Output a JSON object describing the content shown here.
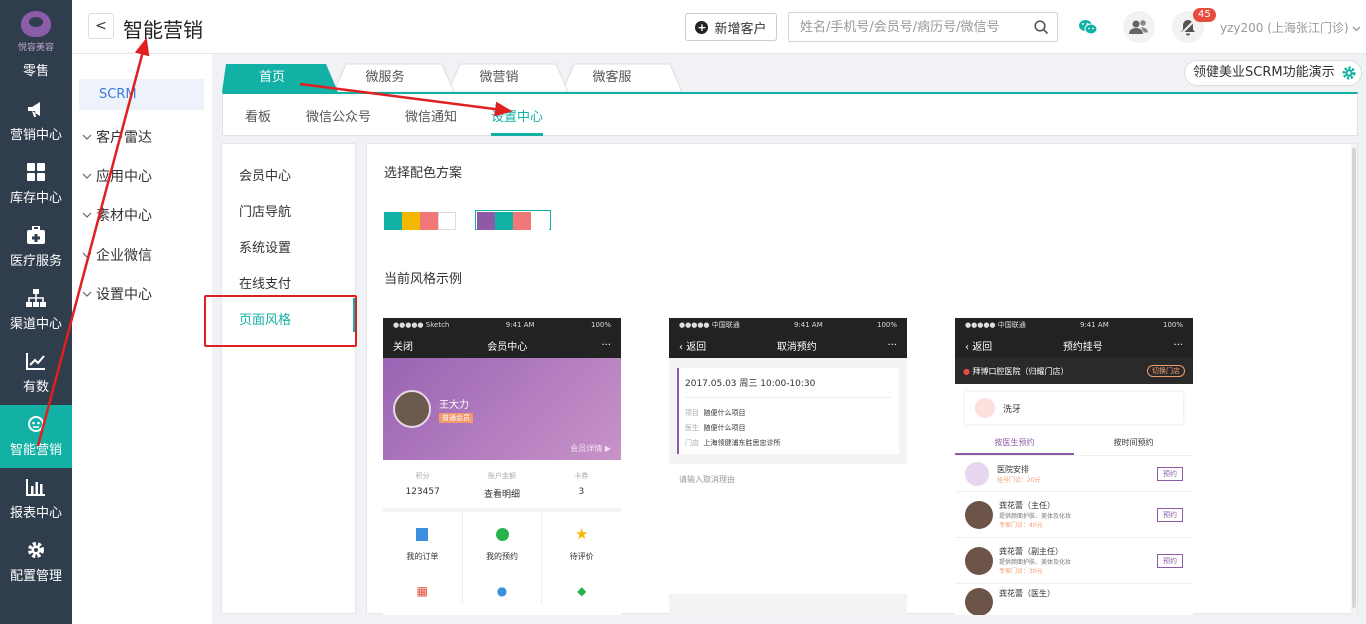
{
  "nav": {
    "logo_text": "悦容美容",
    "items": [
      {
        "label": "零售",
        "icon": "retail-icon"
      },
      {
        "label": "营销中心",
        "icon": "megaphone-icon"
      },
      {
        "label": "库存中心",
        "icon": "grid-icon"
      },
      {
        "label": "医疗服务",
        "icon": "medical-kit-icon"
      },
      {
        "label": "渠道中心",
        "icon": "org-chart-icon"
      },
      {
        "label": "有数",
        "icon": "trend-icon"
      },
      {
        "label": "智能营销",
        "icon": "robot-icon",
        "active": true
      },
      {
        "label": "报表中心",
        "icon": "bar-chart-icon"
      },
      {
        "label": "配置管理",
        "icon": "gear-icon"
      }
    ]
  },
  "header": {
    "back": "<",
    "title": "智能营销",
    "add_customer": "新增客户",
    "search_placeholder": "姓名/手机号/会员号/病历号/微信号",
    "notification_count": "45",
    "user": "yzy200 (上海张江门诊)"
  },
  "sub_sidebar": {
    "scrm": "SCRM",
    "items": [
      "客户雷达",
      "应用中心",
      "素材中心",
      "企业微信",
      "设置中心"
    ]
  },
  "tabs": {
    "items": [
      "首页",
      "微服务",
      "微营销",
      "微客服"
    ],
    "active": 0,
    "demo_label": "领健美业SCRM功能演示"
  },
  "subtabs": {
    "items": [
      "看板",
      "微信公众号",
      "微信通知",
      "设置中心"
    ],
    "active": 3
  },
  "settings_menu": {
    "items": [
      "会员中心",
      "门店导航",
      "系统设置",
      "在线支付",
      "页面风格"
    ],
    "active": 4
  },
  "content": {
    "color_scheme_title": "选择配色方案",
    "schemes": [
      {
        "colors": [
          "#13b1a5",
          "#f5b800",
          "#f07878",
          "#ffffff"
        ],
        "selected": false
      },
      {
        "colors": [
          "#8e5aa6",
          "#13b1a5",
          "#f07878",
          "#ffffff"
        ],
        "selected": true
      }
    ],
    "preview_title": "当前风格示例"
  },
  "phone1": {
    "status_left": "●●●●● Sketch",
    "status_time": "9:41 AM",
    "status_right": "100%",
    "close": "关闭",
    "title": "会员中心",
    "more": "···",
    "member_name": "王大力",
    "member_level": "普通会员",
    "member_details": "会员详情",
    "stats": [
      {
        "label": "积分",
        "value": "123457"
      },
      {
        "label": "账户金额",
        "value": "查看明细"
      },
      {
        "label": "卡券",
        "value": "3"
      }
    ],
    "actions": [
      "我的订单",
      "我的预约",
      "待评价"
    ]
  },
  "phone2": {
    "status_left": "●●●●● 中国联通",
    "status_time": "9:41 AM",
    "status_right": "100%",
    "back": "返回",
    "title": "取消预约",
    "more": "···",
    "datetime": "2017.05.03 周三 10:00-10:30",
    "rows": [
      {
        "k": "项目",
        "v": "随便什么项目"
      },
      {
        "k": "医生",
        "v": "随便什么项目"
      },
      {
        "k": "门店",
        "v": "上海领健浦东胜思忠诊所"
      }
    ],
    "reason_placeholder": "请输入取消理由"
  },
  "phone3": {
    "status_left": "●●●●● 中国联通",
    "status_time": "9:41 AM",
    "status_right": "100%",
    "back": "返回",
    "title": "预约挂号",
    "more": "···",
    "clinic": "拜博口腔医院（归耀门店）",
    "switch_store": "切换门店",
    "service": "洗牙",
    "tab_doctor": "按医生预约",
    "tab_time": "按时间预约",
    "doctors": [
      {
        "name": "医院安排",
        "desc": "",
        "fee": "挂号门诊：20元",
        "btn": "预约"
      },
      {
        "name": "龚花蕾（主任）",
        "desc": "提供颜面护肤、美体及化妆",
        "fee": "专家门诊：40元",
        "btn": "预约"
      },
      {
        "name": "龚花蕾（副主任）",
        "desc": "提供颜面护肤、美体及化妆",
        "fee": "专家门诊：30元",
        "btn": "预约"
      },
      {
        "name": "龚花蕾（医生）",
        "desc": "",
        "fee": "",
        "btn": ""
      }
    ]
  }
}
